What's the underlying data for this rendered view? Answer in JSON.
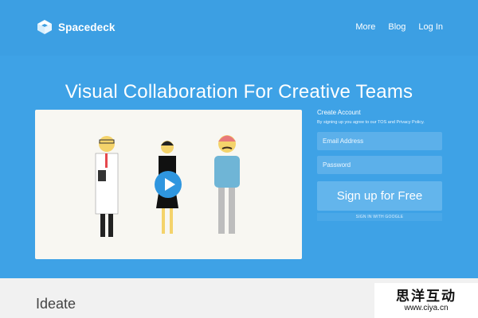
{
  "header": {
    "logo_text": "Spacedeck",
    "nav": [
      "More",
      "Blog",
      "Log In"
    ]
  },
  "hero": {
    "title": "Visual Collaboration For Creative Teams"
  },
  "video": {
    "play_icon": "play-icon"
  },
  "signup": {
    "title": "Create Account",
    "terms": "By signing up you agree to our TOS and Privacy Policy.",
    "email_placeholder": "Email Address",
    "password_placeholder": "Password",
    "cta_label": "Sign up for Free",
    "google_label": "SIGN IN WITH GOOGLE"
  },
  "lower": {
    "heading": "Ideate"
  },
  "watermark": {
    "title": "思洋互动",
    "url": "www.ciya.cn"
  },
  "colors": {
    "background": "#3ea2e6",
    "topbar": "#3c9fe3",
    "field": "#5cb0ea",
    "cta": "#63b5ec",
    "lower_section": "#f1f1f1"
  }
}
